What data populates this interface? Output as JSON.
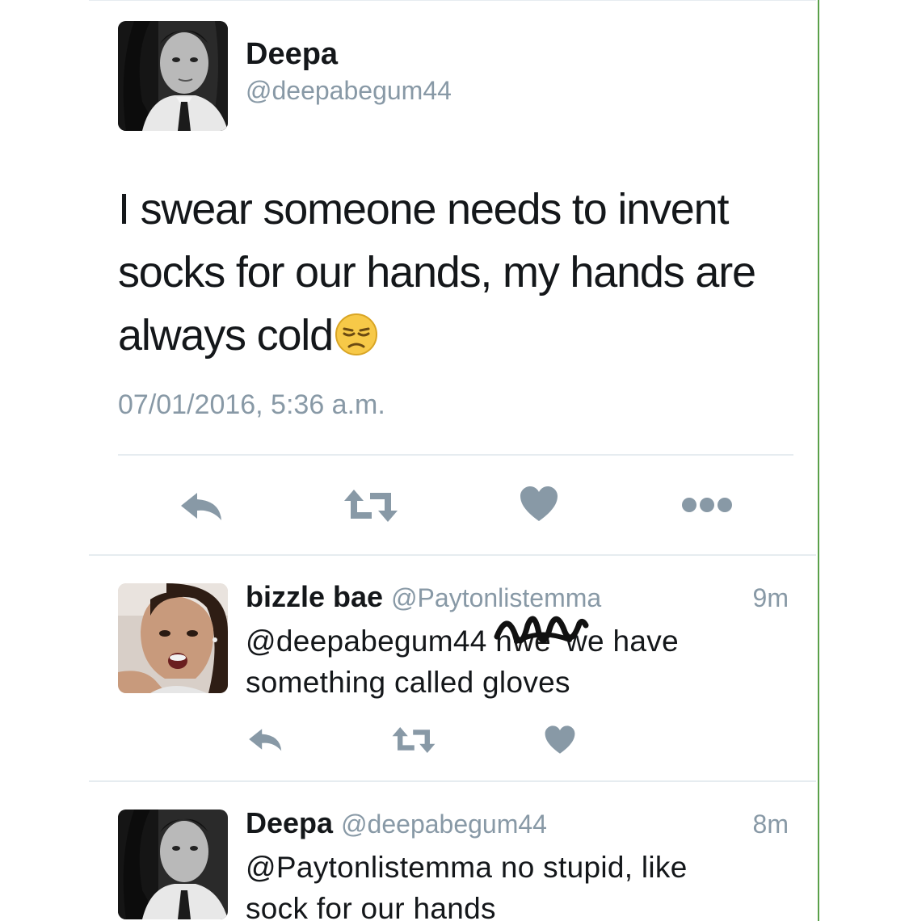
{
  "main_tweet": {
    "author_name": "Deepa",
    "author_handle": "@deepabegum44",
    "text": "I swear someone needs to invent socks for our hands, my hands are always cold",
    "emoji": "unamused-face-emoji",
    "timestamp": "07/01/2016, 5:36 a.m.",
    "actions": [
      "reply-icon",
      "retweet-icon",
      "like-icon",
      "more-icon"
    ]
  },
  "replies": [
    {
      "author_name": "bizzle bae",
      "author_handle": "@Paytonlistemma",
      "time": "9m",
      "mention": "@deepabegum44",
      "text_before": "n",
      "scribbled_text": "we",
      "text_after": "we have something called gloves",
      "actions": [
        "reply-icon",
        "retweet-icon",
        "like-icon"
      ]
    },
    {
      "author_name": "Deepa",
      "author_handle": "@deepabegum44",
      "time": "8m",
      "text": "@Paytonlistemma no stupid, like sock for our hands"
    }
  ],
  "colors": {
    "text": "#14171a",
    "muted": "#8899a6",
    "icon": "#8899a6",
    "divider": "#e6ecf0",
    "frame_edge": "#5aa04a"
  }
}
